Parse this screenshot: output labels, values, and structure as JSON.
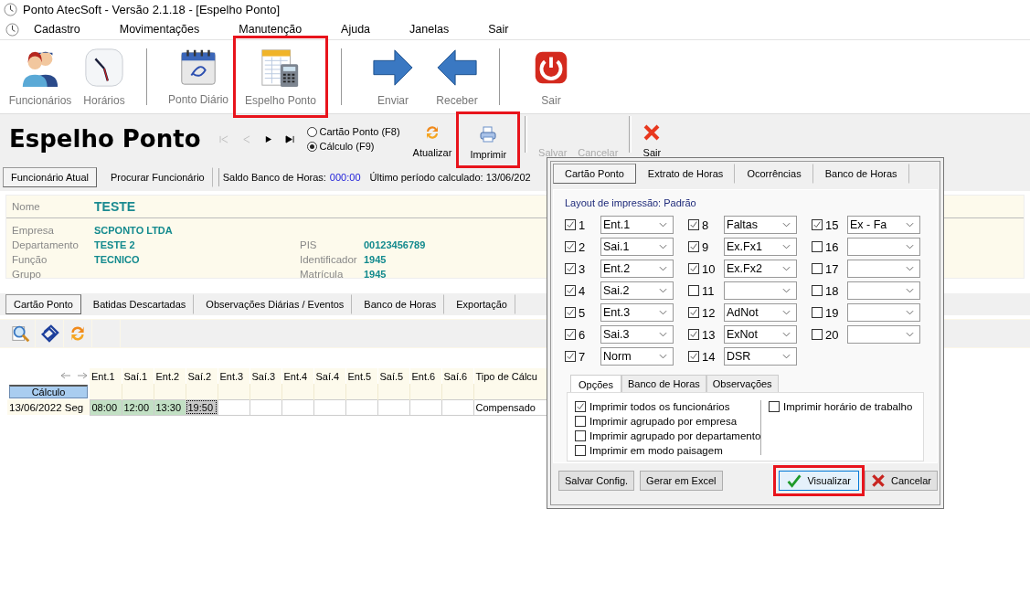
{
  "window": {
    "title": "Ponto AtecSoft - Versão 2.1.18 - [Espelho Ponto]"
  },
  "menu": [
    "Cadastro",
    "Movimentações",
    "Manutenção",
    "Ajuda",
    "Janelas",
    "Sair"
  ],
  "toolbar_groups": [
    [
      {
        "label": "Funcionários",
        "kind": "people",
        "highlighted": false
      },
      {
        "label": "Horários",
        "kind": "clock",
        "highlighted": false
      }
    ],
    [
      {
        "label": "Ponto Diário",
        "kind": "calendar",
        "highlighted": false
      },
      {
        "label": "Espelho Ponto",
        "kind": "sheet",
        "highlighted": true
      }
    ],
    [
      {
        "label": "Enviar",
        "kind": "send",
        "highlighted": false
      },
      {
        "label": "Receber",
        "kind": "receive",
        "highlighted": false
      }
    ],
    [
      {
        "label": "Sair",
        "kind": "power",
        "highlighted": false
      }
    ]
  ],
  "header": {
    "title": "Espelho Ponto"
  },
  "nav_buttons": [
    {
      "kind": "first",
      "disabled": true
    },
    {
      "kind": "prev",
      "disabled": true
    },
    {
      "kind": "next",
      "disabled": false
    },
    {
      "kind": "last",
      "disabled": false
    }
  ],
  "view_radios": [
    {
      "label": "Cartão Ponto (F8)",
      "selected": false
    },
    {
      "label": "Cálculo (F9)",
      "selected": true
    }
  ],
  "actions": [
    {
      "label": "Atualizar",
      "kind": "refresh",
      "disabled": false,
      "highlighted": false
    },
    {
      "label": "Imprimir",
      "kind": "print",
      "disabled": false,
      "highlighted": true
    },
    {
      "label": "Salvar",
      "kind": "text",
      "disabled": true,
      "highlighted": false
    },
    {
      "label": "Cancelar",
      "kind": "text",
      "disabled": true,
      "highlighted": false
    },
    {
      "label": "Sair",
      "kind": "close",
      "disabled": false,
      "highlighted": false
    }
  ],
  "employee_tabs": [
    {
      "label": "Funcionário Atual",
      "selected": true
    },
    {
      "label": "Procurar Funcionário",
      "selected": false
    }
  ],
  "status": {
    "balance_label": "Saldo Banco de Horas:",
    "balance": "000:00",
    "last_period": "Último período calculado: 13/06/202"
  },
  "employee": {
    "name_label": "Nome",
    "name": "TESTE",
    "fields_left": [
      {
        "label": "Empresa",
        "value": "SCPONTO LTDA"
      },
      {
        "label": "Departamento",
        "value": "TESTE 2"
      },
      {
        "label": "Função",
        "value": "TECNICO"
      },
      {
        "label": "Grupo"
      }
    ],
    "fields_right": [
      {
        "label": "PIS",
        "value": "00123456789"
      },
      {
        "label": "Identificador",
        "value": "1945"
      },
      {
        "label": "Matrícula",
        "value": "1945"
      }
    ]
  },
  "detail_tabs": [
    {
      "label": "Cartão Ponto",
      "selected": true
    },
    {
      "label": "Batidas Descartadas",
      "selected": false
    },
    {
      "label": "Observações Diárias / Eventos",
      "selected": false
    },
    {
      "label": "Banco de Horas",
      "selected": false
    },
    {
      "label": "Exportação",
      "selected": false
    }
  ],
  "detail_tools": [
    {
      "kind": "zoom"
    },
    {
      "kind": "clip"
    },
    {
      "kind": "refresh"
    }
  ],
  "grid": {
    "columns": [
      "Ent.1",
      "Saí.1",
      "Ent.2",
      "Saí.2",
      "Ent.3",
      "Saí.3",
      "Ent.4",
      "Saí.4",
      "Ent.5",
      "Saí.5",
      "Ent.6",
      "Saí.6"
    ],
    "last_column": "Tipo de Cálcu",
    "group_label": "Cálculo",
    "rows": [
      {
        "date": "13/06/2022 Seg",
        "calc_type": "Compensado",
        "cells": [
          {
            "value": "08:00",
            "kind": "punch"
          },
          {
            "value": "12:00",
            "kind": "punch"
          },
          {
            "value": "13:30",
            "kind": "punch"
          },
          {
            "value": "19:50",
            "kind": "focused"
          },
          {
            "kind": "empty"
          },
          {
            "kind": "empty"
          },
          {
            "kind": "empty"
          },
          {
            "kind": "empty"
          },
          {
            "kind": "empty"
          },
          {
            "kind": "empty"
          },
          {
            "kind": "empty"
          },
          {
            "kind": "empty"
          }
        ]
      }
    ]
  },
  "dialog": {
    "tabs": [
      {
        "label": "Cartão Ponto",
        "selected": true
      },
      {
        "label": "Extrato de Horas",
        "selected": false
      },
      {
        "label": "Ocorrências",
        "selected": false
      },
      {
        "label": "Banco de Horas",
        "selected": false
      }
    ],
    "layout_label": "Layout de impressão: Padrão",
    "columns": [
      [
        {
          "number": "1",
          "checked": true,
          "value": "Ent.1"
        },
        {
          "number": "2",
          "checked": true,
          "value": "Sai.1"
        },
        {
          "number": "3",
          "checked": true,
          "value": "Ent.2"
        },
        {
          "number": "4",
          "checked": true,
          "value": "Sai.2"
        },
        {
          "number": "5",
          "checked": true,
          "value": "Ent.3"
        },
        {
          "number": "6",
          "checked": true,
          "value": "Sai.3"
        },
        {
          "number": "7",
          "checked": true,
          "value": "Norm"
        }
      ],
      [
        {
          "number": "8",
          "checked": true,
          "value": "Faltas"
        },
        {
          "number": "9",
          "checked": true,
          "value": "Ex.Fx1"
        },
        {
          "number": "10",
          "checked": true,
          "value": "Ex.Fx2"
        },
        {
          "number": "11",
          "checked": false
        },
        {
          "number": "12",
          "checked": true,
          "value": "AdNot"
        },
        {
          "number": "13",
          "checked": true,
          "value": "ExNot"
        },
        {
          "number": "14",
          "checked": true,
          "value": "DSR"
        }
      ],
      [
        {
          "number": "15",
          "checked": true,
          "value": "Ex - Fa"
        },
        {
          "number": "16",
          "checked": false
        },
        {
          "number": "17",
          "checked": false
        },
        {
          "number": "18",
          "checked": false
        },
        {
          "number": "19",
          "checked": false
        },
        {
          "number": "20",
          "checked": false
        }
      ]
    ],
    "option_tabs": [
      {
        "label": "Opções",
        "selected": true
      },
      {
        "label": "Banco de Horas",
        "selected": false
      },
      {
        "label": "Observações",
        "selected": false
      }
    ],
    "options_left": [
      {
        "label": "Imprimir todos os funcionários",
        "checked": true
      },
      {
        "label": "Imprimir agrupado por empresa",
        "checked": false
      },
      {
        "label": "Imprimir agrupado por departamento",
        "checked": false
      },
      {
        "label": "Imprimir em modo paisagem",
        "checked": false
      }
    ],
    "options_right": [
      {
        "label": "Imprimir horário de trabalho",
        "checked": false
      }
    ],
    "buttons": [
      {
        "label": "Salvar Config.",
        "kind": "plain",
        "highlighted": false
      },
      {
        "label": "Gerar em Excel",
        "kind": "plain",
        "highlighted": false
      },
      {
        "label": "Visualizar",
        "kind": "confirm",
        "highlighted": true
      },
      {
        "label": "Cancelar",
        "kind": "cancel",
        "highlighted": false
      }
    ]
  }
}
